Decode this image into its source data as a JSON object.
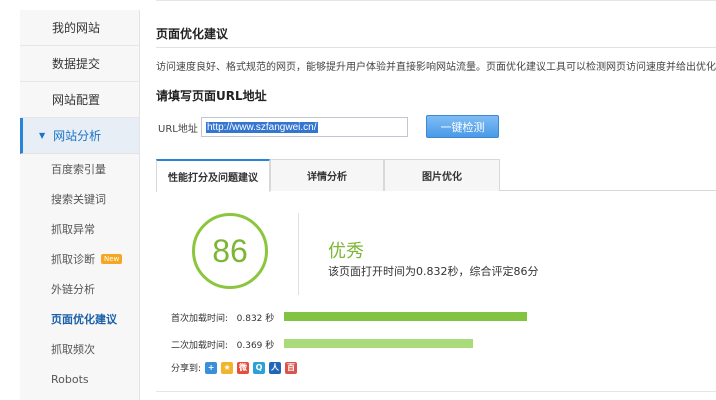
{
  "sidebar": {
    "top_items": [
      {
        "label": "我的网站"
      },
      {
        "label": "数据提交"
      },
      {
        "label": "网站配置"
      }
    ],
    "active_group": {
      "label": "网站分析"
    },
    "sub_items": [
      {
        "label": "百度索引量"
      },
      {
        "label": "搜索关键词"
      },
      {
        "label": "抓取异常"
      },
      {
        "label": "抓取诊断",
        "badge": "New"
      },
      {
        "label": "外链分析"
      },
      {
        "label": "页面优化建议"
      },
      {
        "label": "抓取频次"
      },
      {
        "label": "Robots"
      }
    ]
  },
  "main": {
    "title": "页面优化建议",
    "description": "访问速度良好、格式规范的网页，能够提升用户体验并直接影响网站流量。页面优化建议工具可以检测网页访问速度并给出优化建议。",
    "section_title": "请填写页面URL地址",
    "url_label": "URL地址",
    "url_value": "http://www.szfangwei.cn/",
    "check_button": "一键检测",
    "tabs": [
      {
        "label": "性能打分及问题建议"
      },
      {
        "label": "详情分析"
      },
      {
        "label": "图片优化"
      }
    ]
  },
  "result": {
    "score": "86",
    "grade": "优秀",
    "summary": "该页面打开时间为0.832秒，综合评定86分",
    "first_load_label": "首次加载时间:",
    "first_load_value": "0.832 秒",
    "first_load_seconds": 0.832,
    "second_load_label": "二次加载时间:",
    "second_load_value": "0.369 秒",
    "second_load_seconds": 0.369,
    "share_label": "分享到:",
    "share_icons": [
      "qzone-icon",
      "favorites-icon",
      "weibo-icon",
      "tencent-weibo-icon",
      "renren-icon",
      "baidu-icon"
    ],
    "colors": {
      "accent": "#2a84d6",
      "score_green": "#7db536",
      "bar_first": "#82c341",
      "bar_second": "#a9db7a"
    }
  }
}
